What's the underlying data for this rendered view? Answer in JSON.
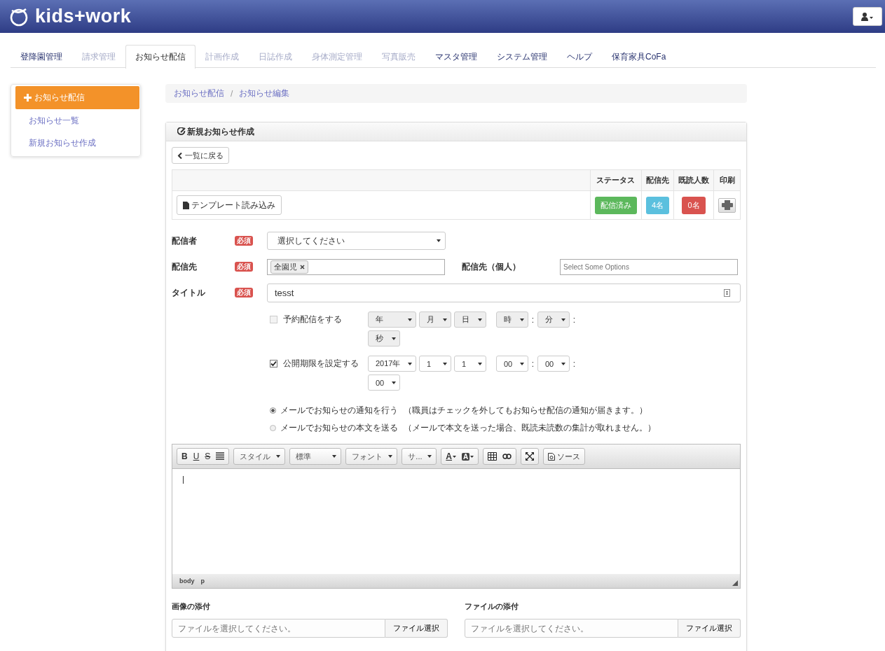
{
  "header": {
    "logo": "kids+work"
  },
  "tabs": [
    {
      "label": "登降園管理",
      "selected": false,
      "disabled": false
    },
    {
      "label": "請求管理",
      "selected": false,
      "disabled": true
    },
    {
      "label": "お知らせ配信",
      "selected": true,
      "disabled": false
    },
    {
      "label": "計画作成",
      "selected": false,
      "disabled": true
    },
    {
      "label": "日誌作成",
      "selected": false,
      "disabled": true
    },
    {
      "label": "身体測定管理",
      "selected": false,
      "disabled": true
    },
    {
      "label": "写真販売",
      "selected": false,
      "disabled": true
    },
    {
      "label": "マスタ管理",
      "selected": false,
      "disabled": false
    },
    {
      "label": "システム管理",
      "selected": false,
      "disabled": false
    },
    {
      "label": "ヘルプ",
      "selected": false,
      "disabled": false
    },
    {
      "label": "保育家具CoFa",
      "selected": false,
      "disabled": false
    }
  ],
  "sidebar": {
    "items": [
      {
        "label": "お知らせ配信",
        "selected": true
      },
      {
        "label": "お知らせ一覧",
        "selected": false
      },
      {
        "label": "新規お知らせ作成",
        "selected": false
      }
    ]
  },
  "breadcrumb": [
    "お知らせ配信",
    "お知らせ編集"
  ],
  "breadcrumb_separator": "/",
  "panel": {
    "title": "新規お知らせ作成",
    "back_button": "一覧に戻る",
    "table": {
      "columns": [
        "ステータス",
        "配信先",
        "既読人数",
        "印刷"
      ],
      "template_button": "テンプレート読み込み",
      "badges": [
        {
          "label": "配信済み",
          "color": "#5cb85c"
        },
        {
          "label": "4名",
          "color": "#5bc0de"
        },
        {
          "label": "0名",
          "color": "#d9534f"
        }
      ]
    },
    "fields": {
      "sender": {
        "label": "配信者",
        "required": "必須",
        "value": "選択してください"
      },
      "recipients": {
        "label": "配信先",
        "required": "必須",
        "tags": [
          "全園児"
        ],
        "personal_label": "配信先（個人）",
        "personal_placeholder": "Select Some Options"
      },
      "title": {
        "label": "タイトル",
        "required": "必須",
        "value": "tesst"
      }
    },
    "schedules": [
      {
        "label": "予約配信をする",
        "checked": false,
        "date": [
          "年",
          "月",
          "日"
        ],
        "time": [
          "時",
          "分",
          "秒"
        ],
        "separators": [
          ":",
          ":"
        ]
      },
      {
        "label": "公開期限を設定する",
        "checked": true,
        "date": [
          "2017年",
          "1",
          "1"
        ],
        "time": [
          "00",
          "00",
          "00"
        ],
        "separators": [
          ":",
          ":"
        ]
      }
    ],
    "mail_options": [
      {
        "label": "メールでお知らせの通知を行う",
        "note": "（職員はチェックを外してもお知らせ配信の通知が届きます。）",
        "selected": true
      },
      {
        "label": "メールでお知らせの本文を送る",
        "note": "（メールで本文を送った場合、既読未読数の集計が取れません。）",
        "selected": false
      }
    ],
    "editor": {
      "format_buttons": [
        "B",
        "U",
        "S"
      ],
      "dropdowns": [
        "スタイル",
        "標準",
        "フォント",
        "サ..."
      ],
      "color_buttons": [
        "A",
        "A"
      ],
      "source_button": "ソース",
      "path": [
        "body",
        "p"
      ]
    },
    "attachments": [
      {
        "label": "画像の添付",
        "placeholder": "ファイルを選択してください。",
        "button": "ファイル選択"
      },
      {
        "label": "ファイルの添付",
        "placeholder": "ファイルを選択してください。",
        "button": "ファイル選択"
      }
    ]
  }
}
